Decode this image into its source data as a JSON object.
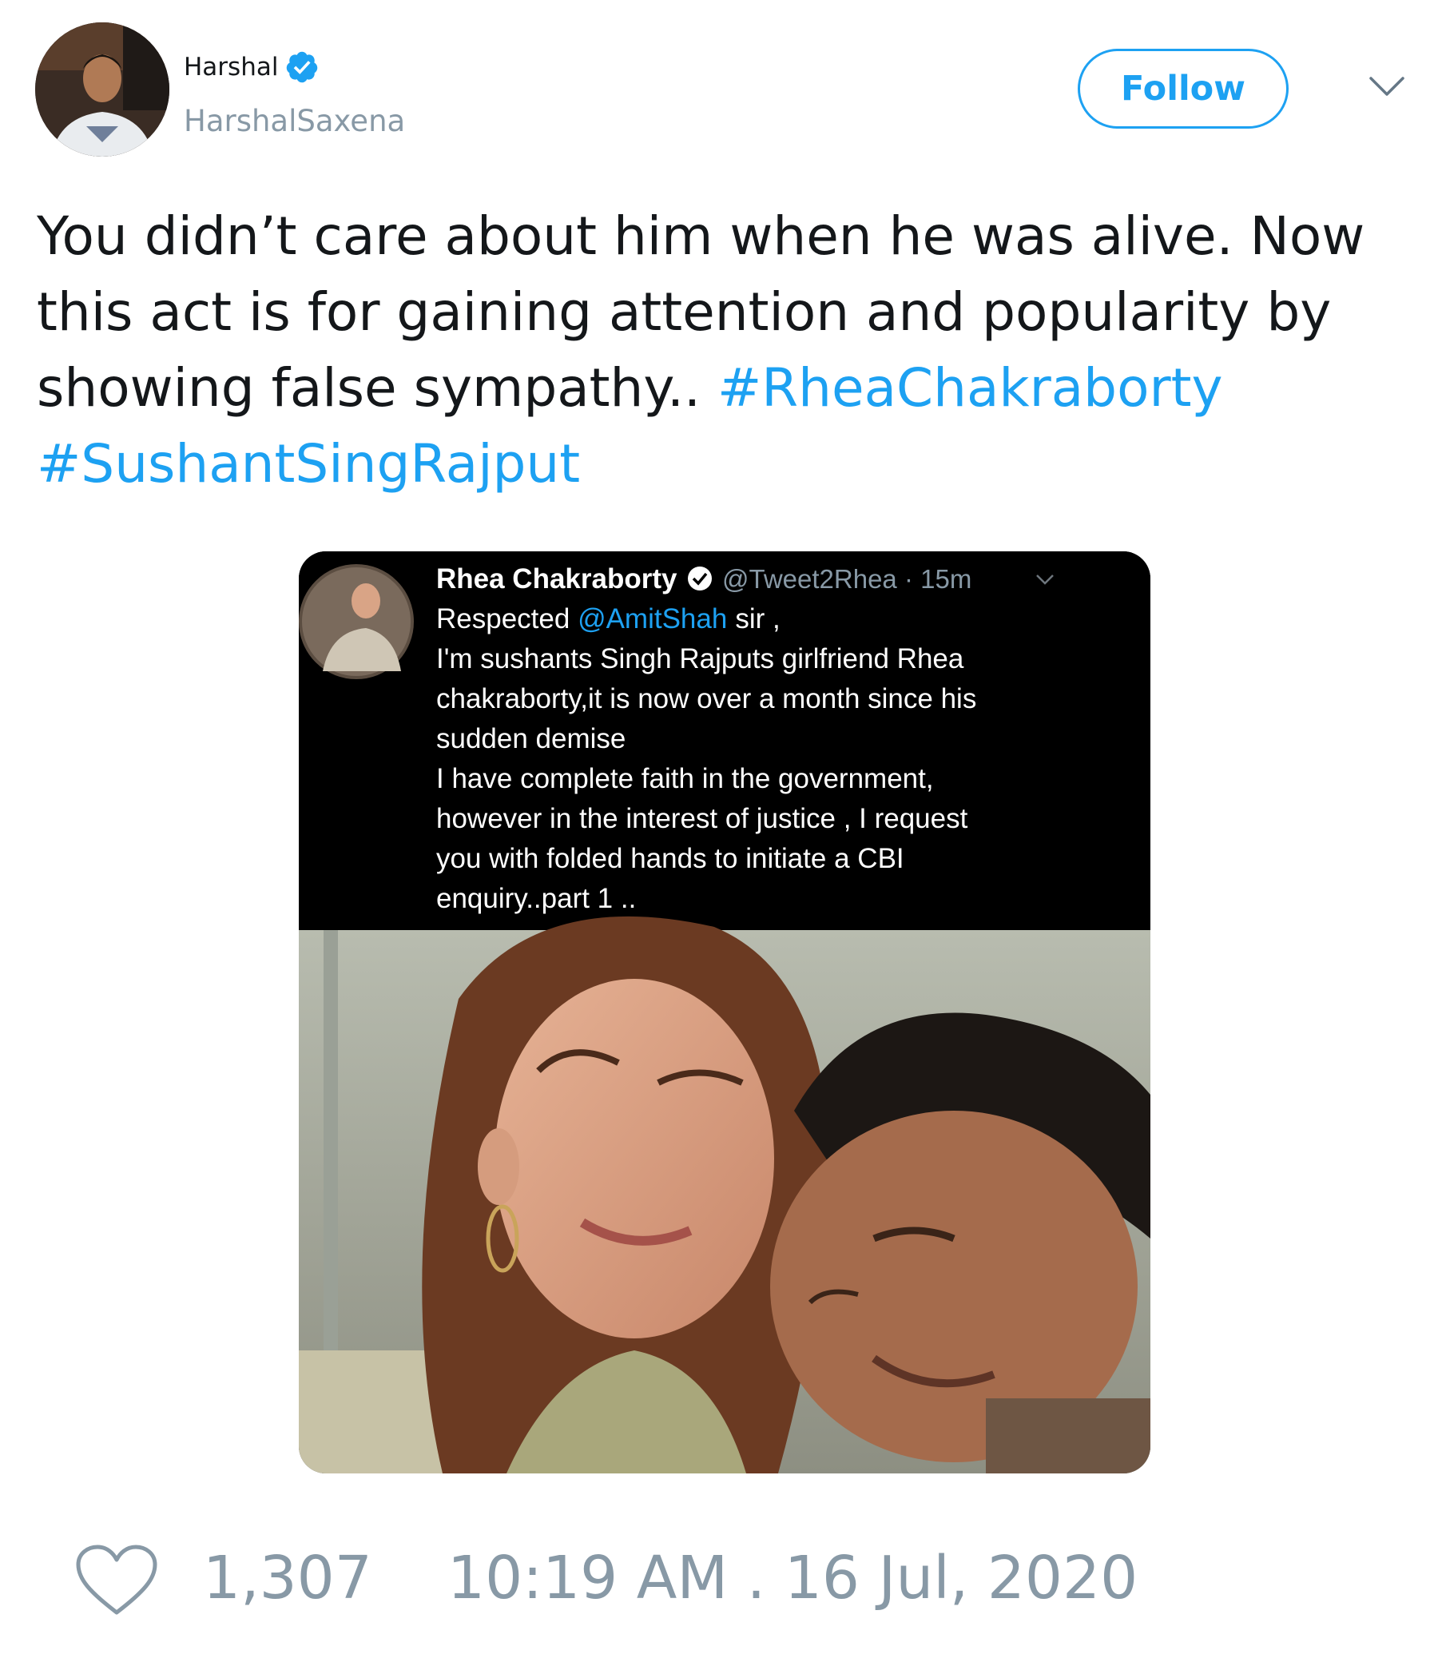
{
  "author": {
    "display_name": "Harshal",
    "handle": "HarshalSaxena",
    "verified": true
  },
  "header": {
    "follow_label": "Follow",
    "menu_icon": "chevron-down-icon"
  },
  "tweet": {
    "text_parts": [
      "You didn’t care about him when he was alive. Now this act is for gaining attention and popularity by showing false sympathy.. ",
      "#RheaChakraborty",
      " ",
      "#SushantSingRajput"
    ]
  },
  "embedded_screenshot": {
    "display_name": "Rhea Chakraborty",
    "handle_time": "@Tweet2Rhea · 15m",
    "text_prefix": "Respected ",
    "mention": "@AmitShah",
    "text_lines": [
      "sir  ,",
      "I'm sushants Singh Rajputs girlfriend Rhea",
      "chakraborty,it is now over a month since his",
      "sudden demise",
      "I have complete faith in the government,",
      "however in the interest of justice , I request",
      "you with folded hands to initiate a CBI",
      "enquiry..part 1 .."
    ]
  },
  "footer": {
    "like_count": "1,307",
    "timestamp": "10:19 AM . 16 Jul, 2020"
  },
  "colors": {
    "accent": "#1da1f2",
    "muted": "#8899a6",
    "text": "#14171a"
  }
}
